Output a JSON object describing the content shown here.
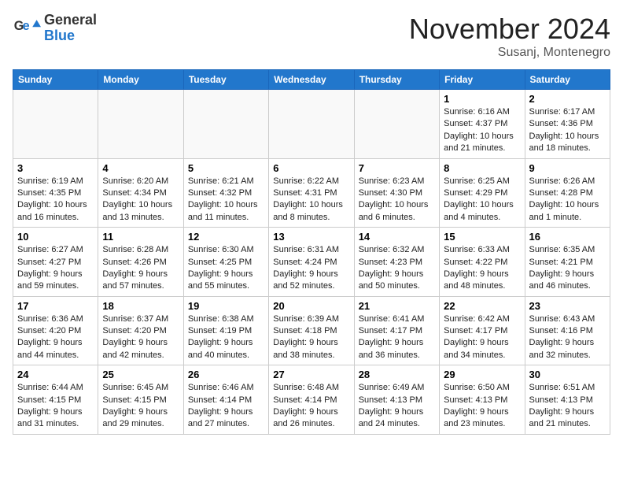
{
  "header": {
    "logo_general": "General",
    "logo_blue": "Blue",
    "month_title": "November 2024",
    "location": "Susanj, Montenegro"
  },
  "days_of_week": [
    "Sunday",
    "Monday",
    "Tuesday",
    "Wednesday",
    "Thursday",
    "Friday",
    "Saturday"
  ],
  "weeks": [
    [
      {
        "day": "",
        "info": ""
      },
      {
        "day": "",
        "info": ""
      },
      {
        "day": "",
        "info": ""
      },
      {
        "day": "",
        "info": ""
      },
      {
        "day": "",
        "info": ""
      },
      {
        "day": "1",
        "info": "Sunrise: 6:16 AM\nSunset: 4:37 PM\nDaylight: 10 hours\nand 21 minutes."
      },
      {
        "day": "2",
        "info": "Sunrise: 6:17 AM\nSunset: 4:36 PM\nDaylight: 10 hours\nand 18 minutes."
      }
    ],
    [
      {
        "day": "3",
        "info": "Sunrise: 6:19 AM\nSunset: 4:35 PM\nDaylight: 10 hours\nand 16 minutes."
      },
      {
        "day": "4",
        "info": "Sunrise: 6:20 AM\nSunset: 4:34 PM\nDaylight: 10 hours\nand 13 minutes."
      },
      {
        "day": "5",
        "info": "Sunrise: 6:21 AM\nSunset: 4:32 PM\nDaylight: 10 hours\nand 11 minutes."
      },
      {
        "day": "6",
        "info": "Sunrise: 6:22 AM\nSunset: 4:31 PM\nDaylight: 10 hours\nand 8 minutes."
      },
      {
        "day": "7",
        "info": "Sunrise: 6:23 AM\nSunset: 4:30 PM\nDaylight: 10 hours\nand 6 minutes."
      },
      {
        "day": "8",
        "info": "Sunrise: 6:25 AM\nSunset: 4:29 PM\nDaylight: 10 hours\nand 4 minutes."
      },
      {
        "day": "9",
        "info": "Sunrise: 6:26 AM\nSunset: 4:28 PM\nDaylight: 10 hours\nand 1 minute."
      }
    ],
    [
      {
        "day": "10",
        "info": "Sunrise: 6:27 AM\nSunset: 4:27 PM\nDaylight: 9 hours\nand 59 minutes."
      },
      {
        "day": "11",
        "info": "Sunrise: 6:28 AM\nSunset: 4:26 PM\nDaylight: 9 hours\nand 57 minutes."
      },
      {
        "day": "12",
        "info": "Sunrise: 6:30 AM\nSunset: 4:25 PM\nDaylight: 9 hours\nand 55 minutes."
      },
      {
        "day": "13",
        "info": "Sunrise: 6:31 AM\nSunset: 4:24 PM\nDaylight: 9 hours\nand 52 minutes."
      },
      {
        "day": "14",
        "info": "Sunrise: 6:32 AM\nSunset: 4:23 PM\nDaylight: 9 hours\nand 50 minutes."
      },
      {
        "day": "15",
        "info": "Sunrise: 6:33 AM\nSunset: 4:22 PM\nDaylight: 9 hours\nand 48 minutes."
      },
      {
        "day": "16",
        "info": "Sunrise: 6:35 AM\nSunset: 4:21 PM\nDaylight: 9 hours\nand 46 minutes."
      }
    ],
    [
      {
        "day": "17",
        "info": "Sunrise: 6:36 AM\nSunset: 4:20 PM\nDaylight: 9 hours\nand 44 minutes."
      },
      {
        "day": "18",
        "info": "Sunrise: 6:37 AM\nSunset: 4:20 PM\nDaylight: 9 hours\nand 42 minutes."
      },
      {
        "day": "19",
        "info": "Sunrise: 6:38 AM\nSunset: 4:19 PM\nDaylight: 9 hours\nand 40 minutes."
      },
      {
        "day": "20",
        "info": "Sunrise: 6:39 AM\nSunset: 4:18 PM\nDaylight: 9 hours\nand 38 minutes."
      },
      {
        "day": "21",
        "info": "Sunrise: 6:41 AM\nSunset: 4:17 PM\nDaylight: 9 hours\nand 36 minutes."
      },
      {
        "day": "22",
        "info": "Sunrise: 6:42 AM\nSunset: 4:17 PM\nDaylight: 9 hours\nand 34 minutes."
      },
      {
        "day": "23",
        "info": "Sunrise: 6:43 AM\nSunset: 4:16 PM\nDaylight: 9 hours\nand 32 minutes."
      }
    ],
    [
      {
        "day": "24",
        "info": "Sunrise: 6:44 AM\nSunset: 4:15 PM\nDaylight: 9 hours\nand 31 minutes."
      },
      {
        "day": "25",
        "info": "Sunrise: 6:45 AM\nSunset: 4:15 PM\nDaylight: 9 hours\nand 29 minutes."
      },
      {
        "day": "26",
        "info": "Sunrise: 6:46 AM\nSunset: 4:14 PM\nDaylight: 9 hours\nand 27 minutes."
      },
      {
        "day": "27",
        "info": "Sunrise: 6:48 AM\nSunset: 4:14 PM\nDaylight: 9 hours\nand 26 minutes."
      },
      {
        "day": "28",
        "info": "Sunrise: 6:49 AM\nSunset: 4:13 PM\nDaylight: 9 hours\nand 24 minutes."
      },
      {
        "day": "29",
        "info": "Sunrise: 6:50 AM\nSunset: 4:13 PM\nDaylight: 9 hours\nand 23 minutes."
      },
      {
        "day": "30",
        "info": "Sunrise: 6:51 AM\nSunset: 4:13 PM\nDaylight: 9 hours\nand 21 minutes."
      }
    ]
  ]
}
